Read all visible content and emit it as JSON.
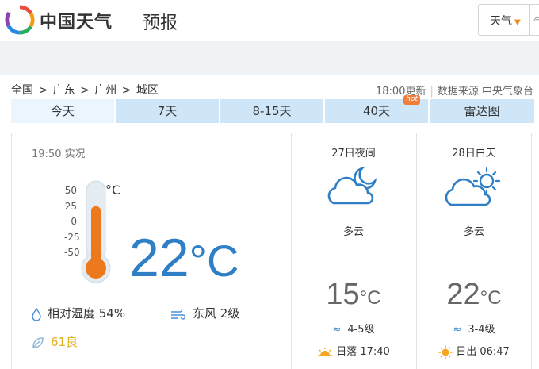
{
  "header": {
    "brand": "中国天气",
    "section": "预报",
    "city_select": "天气",
    "right_partial": "气"
  },
  "breadcrumb": [
    "全国",
    ">",
    "广东",
    ">",
    "广州",
    ">",
    "城区"
  ],
  "update": {
    "time": "18:00更新",
    "source": "数据来源 中央气象台"
  },
  "tabs": [
    {
      "label": "今天"
    },
    {
      "label": "7天"
    },
    {
      "label": "8-15天"
    },
    {
      "label": "40天",
      "badge": "hot"
    },
    {
      "label": "雷达图"
    }
  ],
  "now": {
    "time": "19:50 实况",
    "temperature": "22",
    "unit": "°C",
    "thermo_unit": "°C",
    "scale": [
      "50",
      "25",
      "0",
      "-25",
      "-50"
    ],
    "thermometer_level": 0.72,
    "humidity": "相对湿度  54%",
    "wind": "东风  2级",
    "aqi": "61良"
  },
  "forecast": [
    {
      "date": "27日夜间",
      "icon": "cloudy-night-icon",
      "desc": "多云",
      "temp": "15",
      "unit": "°C",
      "wind": "4-5级",
      "sun": "日落 17:40"
    },
    {
      "date": "28日白天",
      "icon": "cloudy-day-icon",
      "desc": "多云",
      "temp": "22",
      "unit": "°C",
      "wind": "3-4级",
      "sun": "日出 06:47"
    }
  ],
  "colors": {
    "accent_blue": "#2f7fc6",
    "tab_bg": "#cfe6f8",
    "aqi_yellow": "#e3b21c",
    "thermo_orange": "#ec7a1c"
  }
}
